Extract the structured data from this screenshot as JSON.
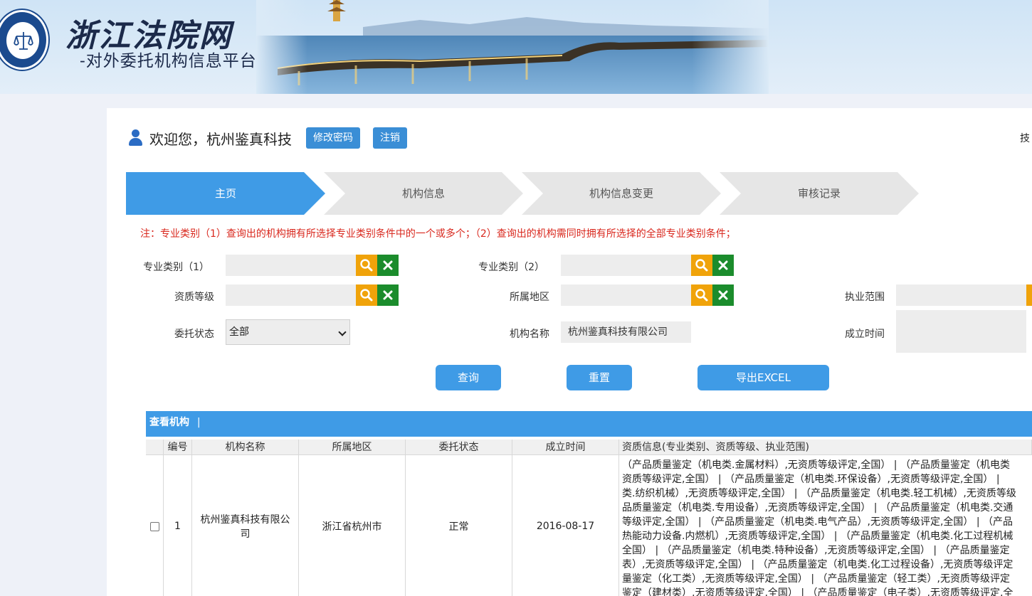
{
  "header": {
    "title": "浙江法院网",
    "subtitle": "-对外委托机构信息平台",
    "seal_text": "ZHEJIANG HIGH PEOPLE'S COURT"
  },
  "user": {
    "welcome": "欢迎您，杭州鉴真科技",
    "change_password": "修改密码",
    "logout": "注销",
    "top_right_text": "技"
  },
  "steps": [
    {
      "label": "主页",
      "active": true
    },
    {
      "label": "机构信息",
      "active": false
    },
    {
      "label": "机构信息变更",
      "active": false
    },
    {
      "label": "审核记录",
      "active": false
    }
  ],
  "note": "注：专业类别（1）查询出的机构拥有所选择专业类别条件中的一个或多个；（2）查询出的机构需同时拥有所选择的全部专业类别条件；",
  "form": {
    "category1_label": "专业类别（1）",
    "category2_label": "专业类别（2）",
    "qualification_label": "资质等级",
    "region_label": "所属地区",
    "scope_label": "执业范围",
    "status_label": "委托状态",
    "status_value": "全部",
    "org_name_label": "机构名称",
    "org_name_value": "杭州鉴真科技有限公司",
    "established_label": "成立时间"
  },
  "actions": {
    "query": "查询",
    "reset": "重置",
    "export": "导出EXCEL"
  },
  "table": {
    "title": "查看机构",
    "title_sep": "|",
    "columns": [
      "编号",
      "机构名称",
      "所属地区",
      "委托状态",
      "成立时间",
      "资质信息(专业类别、资质等级、执业范围)"
    ],
    "rows": [
      {
        "no": "1",
        "name": "杭州鉴真科技有限公司",
        "region": "浙江省杭州市",
        "status": "正常",
        "established": "2016-08-17",
        "qualification_lines": [
          "（产品质量鉴定（机电类.金属材料）,无资质等级评定,全国） | （产品质量鉴定（机电类",
          "资质等级评定,全国） | （产品质量鉴定（机电类.环保设备）,无资质等级评定,全国） |",
          "类.纺织机械）,无资质等级评定,全国） | （产品质量鉴定（机电类.轻工机械）,无资质等级",
          "品质量鉴定（机电类.专用设备）,无资质等级评定,全国） | （产品质量鉴定（机电类.交通",
          "等级评定,全国） | （产品质量鉴定（机电类.电气产品）,无资质等级评定,全国） | （产品",
          "热能动力设备.内燃机）,无资质等级评定,全国） | （产品质量鉴定（机电类.化工过程机械",
          "全国） | （产品质量鉴定（机电类.特种设备）,无资质等级评定,全国） | （产品质量鉴定",
          "表）,无资质等级评定,全国） | （产品质量鉴定（机电类.化工过程设备）,无资质等级评定",
          "量鉴定（化工类）,无资质等级评定,全国） | （产品质量鉴定（轻工类）,无资质等级评定",
          "鉴定（建材类）,无资质等级评定,全国） | （产品质量鉴定（电子类）,无资质等级评定,全"
        ]
      }
    ]
  },
  "colors": {
    "primary": "#3f9be6",
    "step_inactive": "#e6e6e6",
    "search_icon_bg": "#f0a30a",
    "clear_icon_bg": "#1b8c2c",
    "note": "#d9281e"
  }
}
